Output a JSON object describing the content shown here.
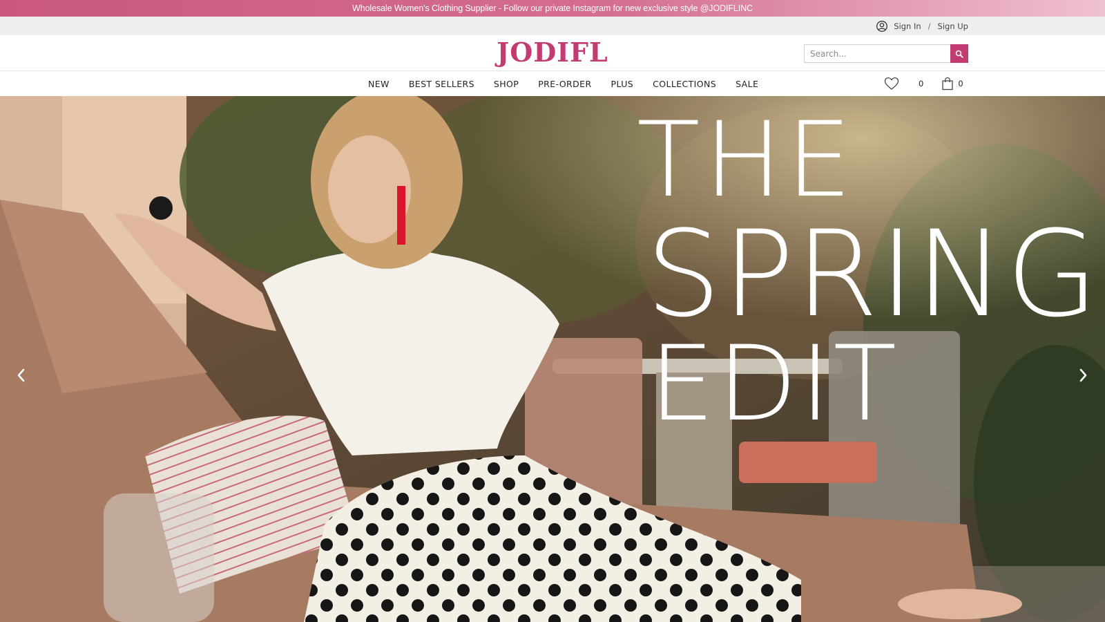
{
  "promo": {
    "text": "Wholesale Women's Clothing Supplier - Follow our private Instagram for new exclusive style @JODIFLINC"
  },
  "account": {
    "sign_in": "Sign In",
    "separator": "/",
    "sign_up": "Sign Up"
  },
  "header": {
    "logo": "JODIFL",
    "search_placeholder": "Search..."
  },
  "nav": {
    "items": [
      {
        "label": "NEW"
      },
      {
        "label": "BEST SELLERS"
      },
      {
        "label": "SHOP"
      },
      {
        "label": "PRE-ORDER"
      },
      {
        "label": "PLUS"
      },
      {
        "label": "COLLECTIONS"
      },
      {
        "label": "SALE"
      }
    ],
    "wishlist_count": "0",
    "cart_count": "0"
  },
  "hero": {
    "line1": "THE",
    "line2": "SPRING",
    "line3": "EDIT"
  },
  "icons": {
    "account": "user-circle-icon",
    "search": "search-icon",
    "wishlist": "heart-icon",
    "cart": "shopping-bag-icon",
    "prev": "chevron-left-icon",
    "next": "chevron-right-icon"
  },
  "colors": {
    "brand": "#c23c72",
    "promo_start": "#c9587c",
    "promo_end": "#efc1cf",
    "utility_bar": "#eeeeee"
  }
}
